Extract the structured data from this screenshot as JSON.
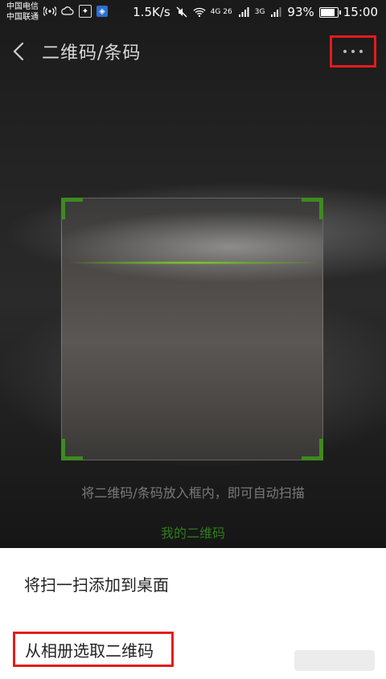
{
  "status_bar": {
    "carrier_1": "中国电信",
    "carrier_2": "中国联通",
    "net_speed": "1.5K/s",
    "signal_1": "4G 26",
    "signal_2": "3G",
    "battery_percent": "93%",
    "battery_level": 0.93,
    "time": "15:00"
  },
  "header": {
    "title": "二维码/条码"
  },
  "scanner": {
    "hint": "将二维码/条码放入框内，即可自动扫描",
    "my_qr_link": "我的二维码"
  },
  "menu": {
    "item_1": "将扫一扫添加到桌面",
    "item_2": "从相册选取二维码"
  },
  "colors": {
    "accent_green": "#3f8a20",
    "highlight_red": "#e31c1c"
  }
}
